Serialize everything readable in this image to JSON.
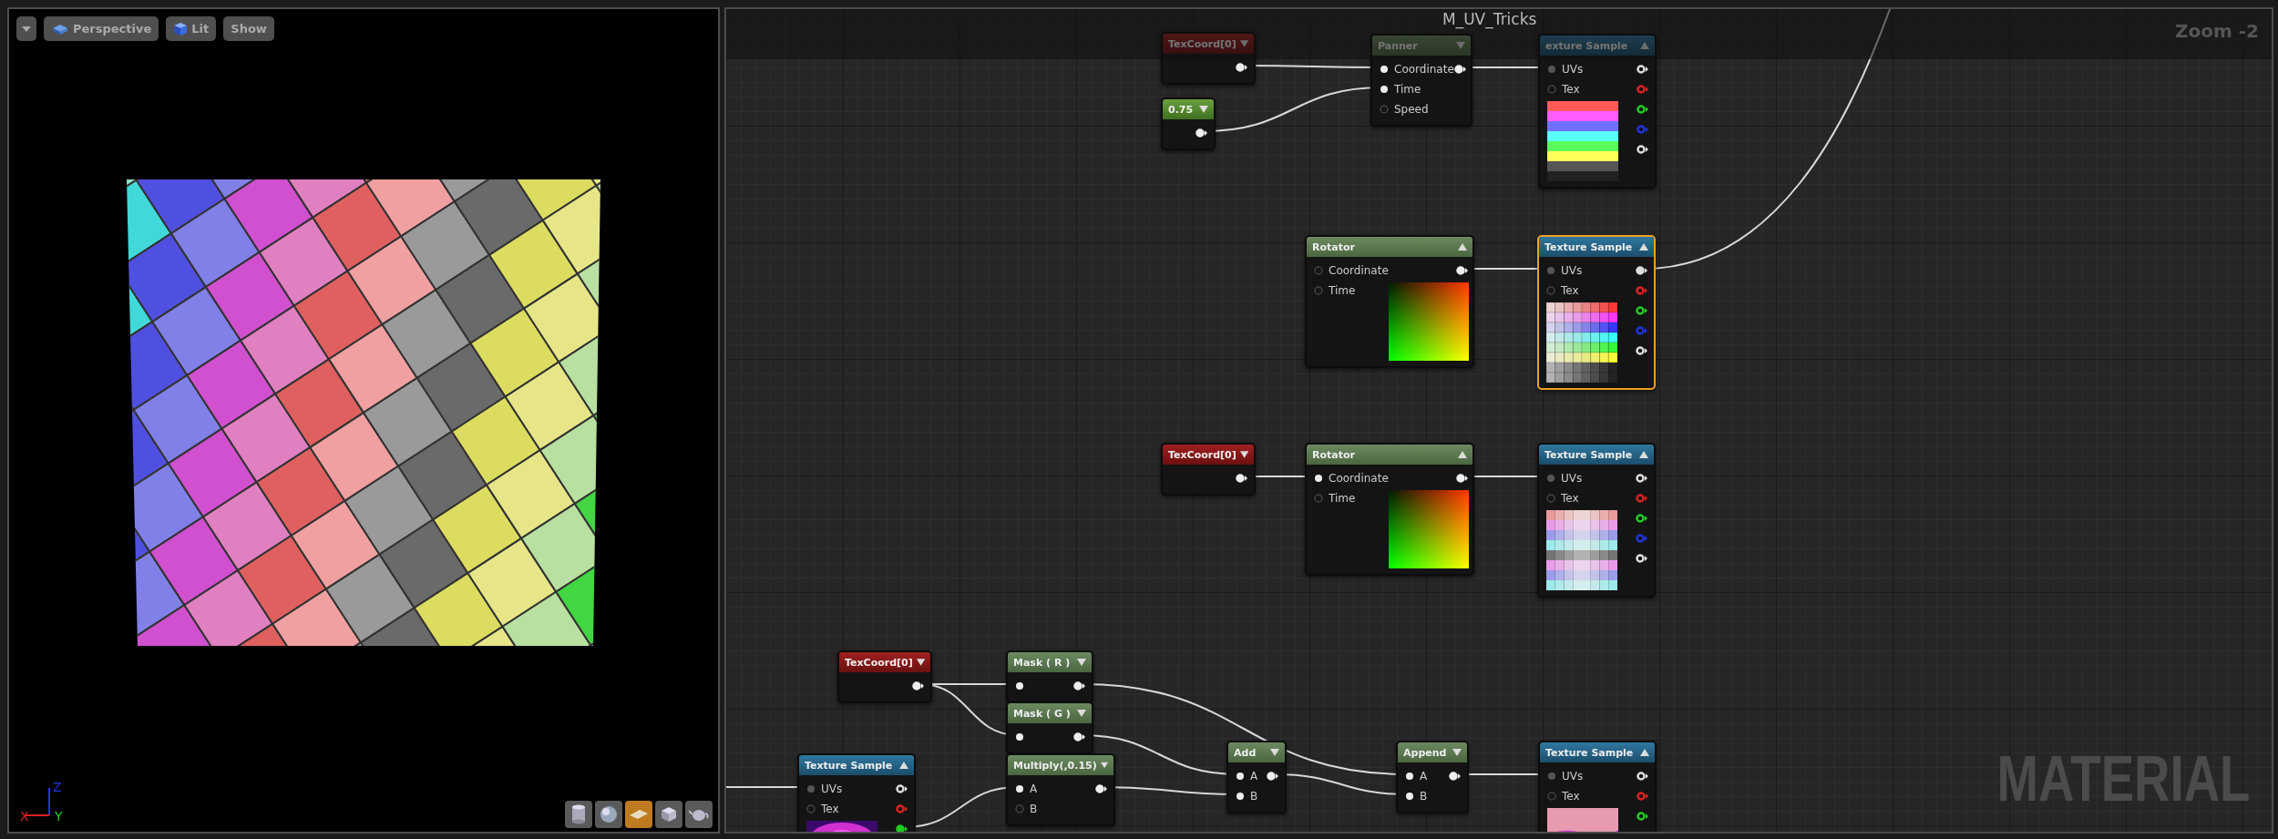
{
  "viewport": {
    "toolbar": [
      {
        "kind": "dropdown"
      },
      {
        "kind": "perspective",
        "label": "Perspective"
      },
      {
        "kind": "lit",
        "label": "Lit"
      },
      {
        "kind": "plain",
        "label": "Show"
      }
    ],
    "axes": [
      {
        "label": "Z",
        "color": "#2233dd"
      },
      {
        "label": "X",
        "color": "#dd2222"
      },
      {
        "label": "Y",
        "color": "#22cc22"
      }
    ],
    "preview_shapes": [
      {
        "kind": "cylinder",
        "selected": false
      },
      {
        "kind": "sphere",
        "selected": false
      },
      {
        "kind": "plane",
        "selected": true
      },
      {
        "kind": "cube",
        "selected": false
      },
      {
        "kind": "teapot",
        "selected": false
      }
    ]
  },
  "graph": {
    "title": "M_UV_Tricks",
    "zoom": "Zoom -2",
    "watermark": "MATERIAL",
    "nodes": [
      {
        "kind": "texcoord",
        "title": "TexCoord[0]",
        "expanded": false,
        "selected": false,
        "outputs": [
          {
            "connected": true
          }
        ]
      },
      {
        "kind": "constant",
        "title": "0.75",
        "expanded": false,
        "selected": false,
        "outputs": [
          {
            "connected": true
          }
        ]
      },
      {
        "kind": "math",
        "title": "Panner",
        "expanded": false,
        "selected": false,
        "inputs": [
          {
            "label": "Coordinate",
            "connected": true
          },
          {
            "label": "Time",
            "connected": true
          },
          {
            "label": "Speed",
            "connected": false
          }
        ],
        "outputs": [
          {
            "connected": true
          }
        ]
      },
      {
        "kind": "texture",
        "title": "exture Sample",
        "expanded": true,
        "selected": false,
        "preview": {
          "kind": "color-bars"
        },
        "inputs": [
          {
            "label": "UVs",
            "connected": true
          },
          {
            "label": "Tex",
            "connected": false
          }
        ],
        "outputs": [
          {
            "color": "#dddddd",
            "connected": false
          },
          {
            "color": "#dd2222",
            "connected": false
          },
          {
            "color": "#22cc22",
            "connected": false
          },
          {
            "color": "#2233dd",
            "connected": false
          },
          {
            "color": "#dddddd",
            "connected": false
          }
        ]
      },
      {
        "kind": "math",
        "title": "Rotator",
        "expanded": true,
        "selected": false,
        "preview": {
          "kind": "gradient"
        },
        "inputs": [
          {
            "label": "Coordinate",
            "connected": false
          },
          {
            "label": "Time",
            "connected": false
          }
        ],
        "outputs": [
          {
            "connected": true
          }
        ]
      },
      {
        "kind": "texture",
        "title": "Texture Sample",
        "expanded": true,
        "selected": true,
        "preview": {
          "kind": "color-grid"
        },
        "inputs": [
          {
            "label": "UVs",
            "connected": true
          },
          {
            "label": "Tex",
            "connected": false
          }
        ],
        "outputs": [
          {
            "color": "#dddddd",
            "connected": true
          },
          {
            "color": "#dd2222",
            "connected": false
          },
          {
            "color": "#22cc22",
            "connected": false
          },
          {
            "color": "#2233dd",
            "connected": false
          },
          {
            "color": "#dddddd",
            "connected": false
          }
        ]
      },
      {
        "kind": "texcoord",
        "title": "TexCoord[0]",
        "expanded": false,
        "selected": false,
        "outputs": [
          {
            "connected": true
          }
        ]
      },
      {
        "kind": "math",
        "title": "Rotator",
        "expanded": true,
        "selected": false,
        "preview": {
          "kind": "gradient"
        },
        "inputs": [
          {
            "label": "Coordinate",
            "connected": true
          },
          {
            "label": "Time",
            "connected": false
          }
        ],
        "outputs": [
          {
            "connected": true
          }
        ]
      },
      {
        "kind": "texture",
        "title": "Texture Sample",
        "expanded": true,
        "selected": false,
        "preview": {
          "kind": "mirrored-grid"
        },
        "inputs": [
          {
            "label": "UVs",
            "connected": true
          },
          {
            "label": "Tex",
            "connected": false
          }
        ],
        "outputs": [
          {
            "color": "#dddddd",
            "connected": false
          },
          {
            "color": "#dd2222",
            "connected": false
          },
          {
            "color": "#22cc22",
            "connected": false
          },
          {
            "color": "#2233dd",
            "connected": false
          },
          {
            "color": "#dddddd",
            "connected": false
          }
        ]
      },
      {
        "kind": "texcoord",
        "title": "TexCoord[0]",
        "expanded": false,
        "selected": false,
        "outputs": [
          {
            "connected": true
          }
        ]
      },
      {
        "kind": "texture",
        "title": "Texture Sample",
        "expanded": true,
        "selected": false,
        "preview": {
          "kind": "magenta"
        },
        "inputs": [
          {
            "label": "UVs",
            "connected": true
          },
          {
            "label": "Tex",
            "connected": false
          }
        ],
        "outputs": [
          {
            "color": "#dddddd",
            "connected": false
          },
          {
            "color": "#dd2222",
            "connected": false
          },
          {
            "color": "#22cc22",
            "connected": true
          }
        ]
      },
      {
        "kind": "math",
        "title": "Mask ( R )",
        "expanded": false,
        "selected": false,
        "inputs": [
          {
            "connected": true
          }
        ],
        "outputs": [
          {
            "connected": true
          }
        ]
      },
      {
        "kind": "math",
        "title": "Mask ( G )",
        "expanded": false,
        "selected": false,
        "inputs": [
          {
            "connected": true
          }
        ],
        "outputs": [
          {
            "connected": true
          }
        ]
      },
      {
        "kind": "math",
        "title": "Multiply(,0.15)",
        "expanded": false,
        "selected": false,
        "inputs": [
          {
            "label": "A",
            "connected": true
          },
          {
            "label": "B",
            "connected": false
          }
        ],
        "outputs": [
          {
            "connected": true
          }
        ]
      },
      {
        "kind": "math",
        "title": "Add",
        "expanded": false,
        "selected": false,
        "inputs": [
          {
            "label": "A",
            "connected": true
          },
          {
            "label": "B",
            "connected": true
          }
        ],
        "outputs": [
          {
            "connected": true
          }
        ]
      },
      {
        "kind": "math",
        "title": "Append",
        "expanded": false,
        "selected": false,
        "inputs": [
          {
            "label": "A",
            "connected": true
          },
          {
            "label": "B",
            "connected": true
          }
        ],
        "outputs": [
          {
            "connected": true
          }
        ]
      },
      {
        "kind": "texture",
        "title": "Texture Sample",
        "expanded": true,
        "selected": false,
        "preview": {
          "kind": "wave"
        },
        "inputs": [
          {
            "label": "UVs",
            "connected": true
          },
          {
            "label": "Tex",
            "connected": false
          }
        ],
        "outputs": [
          {
            "color": "#dddddd",
            "connected": false
          },
          {
            "color": "#dd2222",
            "connected": false
          },
          {
            "color": "#22cc22",
            "connected": false
          }
        ]
      }
    ]
  }
}
